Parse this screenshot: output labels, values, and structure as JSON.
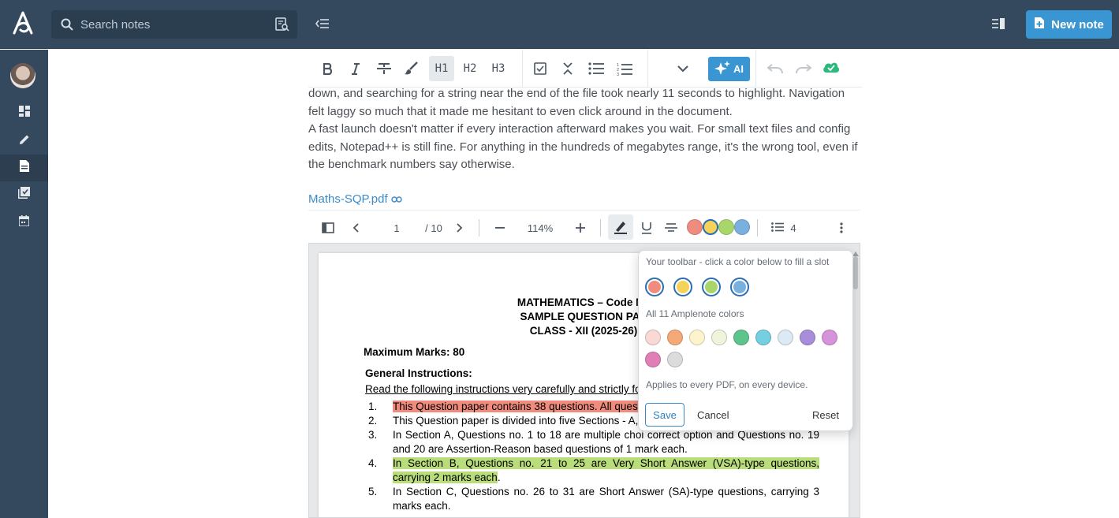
{
  "header": {
    "search_placeholder": "Search notes",
    "new_note_label": "New note"
  },
  "sidebar": {
    "items": [
      {
        "name": "dashboard-icon"
      },
      {
        "name": "pencil-icon"
      },
      {
        "name": "notes-icon",
        "active": true
      },
      {
        "name": "tasks-icon"
      },
      {
        "name": "calendar-icon"
      }
    ]
  },
  "editor_toolbar": {
    "h1": "H1",
    "h2": "H2",
    "h3": "H3",
    "ai_label": "AI"
  },
  "note": {
    "paragraph1": "down, and searching for a string near the end of the file took nearly 11 seconds to highlight. Navigation felt laggy so much that it made me hesitant to even click around in the document.",
    "paragraph2": "A fast launch doesn't matter if every interaction afterward makes you wait. For small text files and config edits, Notepad++ is still fine. For anything in the hundreds of megabytes range, it's the wrong tool, even if the benchmark numbers say otherwise.",
    "attachment": "Maths-SQP.pdf"
  },
  "pdf_toolbar": {
    "page": "1",
    "page_total": "/ 10",
    "zoom": "114%",
    "annotation_count": "4",
    "swatches": [
      "#f08c7e",
      "#f5d35b",
      "#a8d66b",
      "#7ab0de"
    ]
  },
  "pdf": {
    "title1": "MATHEMATICS – Code No",
    "title2": "SAMPLE QUESTION PAP",
    "title3": "CLASS - XII (2025-26)",
    "max_marks": "Maximum Marks: 80",
    "general": "General Instructions:",
    "read": "Read the following instructions very carefully and strictly foll",
    "items": [
      {
        "num": "1.",
        "text": "This Question paper contains 38 questions. All questio"
      },
      {
        "num": "2.",
        "text": "This Question paper is divided into five Sections - A, B"
      },
      {
        "num": "3.",
        "text": "In Section A, Questions no. 1 to 18 are multiple choi correct option and Questions no. 19 and 20 are Assertion-Reason based questions of 1 mark each."
      },
      {
        "num": "4.",
        "text_hl": "In Section B, Questions no. 21 to 25 are Very Short Answer (VSA)-type questions, carrying 2 marks each",
        "text_tail": "."
      },
      {
        "num": "5.",
        "text": "In Section C, Questions no. 26 to 31 are Short Answer (SA)-type questions, carrying 3 marks each."
      }
    ]
  },
  "popup": {
    "toolbar_label": "Your toolbar - click a color below to fill a slot",
    "slots": [
      "#f08c7e",
      "#f5d35b",
      "#a8d66b",
      "#7ab0de"
    ],
    "all_label": "All 11 Amplenote colors",
    "palette": [
      "#f9d9d6",
      "#f5a878",
      "#fdf4cc",
      "#eef5dc",
      "#5dc48c",
      "#74cfe0",
      "#dde9f4",
      "#a88ddb",
      "#d793d9",
      "#e07fb5",
      "#dcdcdc"
    ],
    "applies": "Applies to every PDF, on every device.",
    "save": "Save",
    "cancel": "Cancel",
    "reset": "Reset"
  }
}
